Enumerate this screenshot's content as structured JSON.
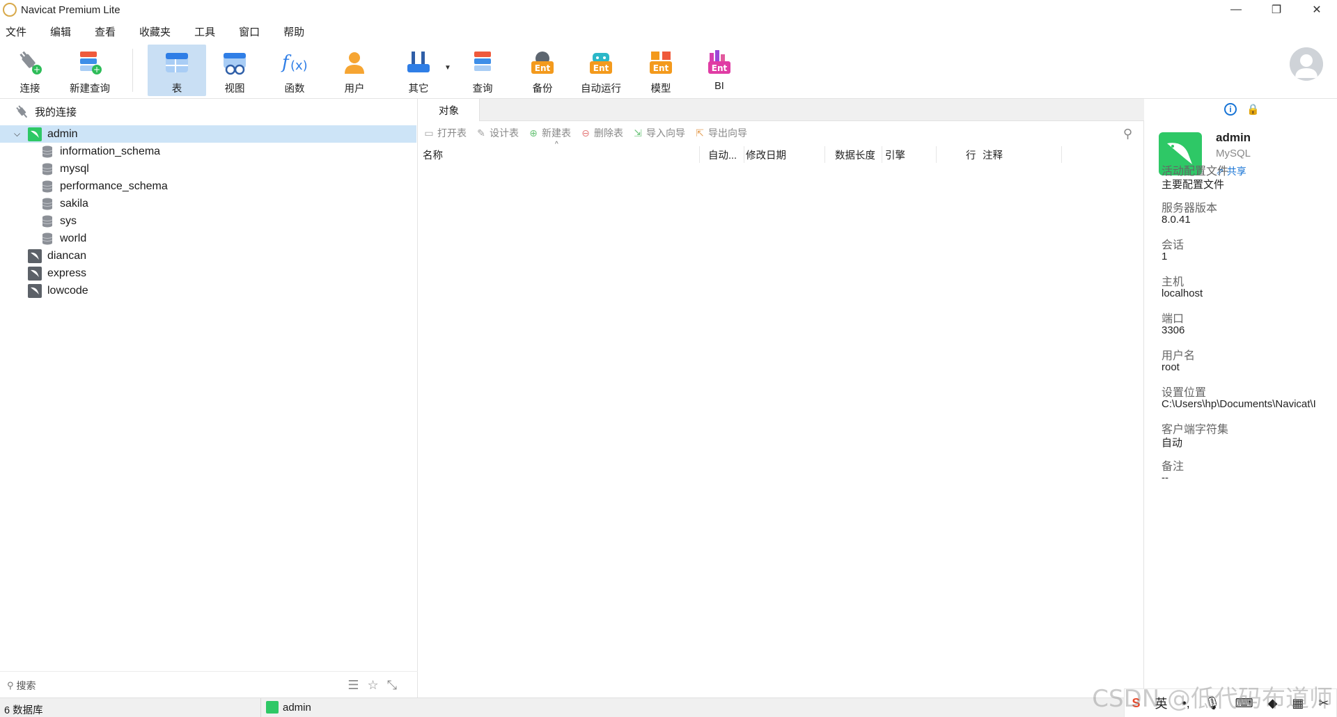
{
  "window": {
    "title": "Navicat Premium Lite",
    "controls": [
      "—",
      "❐",
      "✕"
    ]
  },
  "menu": [
    "文件",
    "编辑",
    "查看",
    "收藏夹",
    "工具",
    "窗口",
    "帮助"
  ],
  "toolbar": {
    "connect": "连接",
    "new_query": "新建查询",
    "table": "表",
    "view": "视图",
    "function": "函数",
    "user": "用户",
    "other": "其它",
    "query": "查询",
    "backup": "备份",
    "automation": "自动运行",
    "model": "模型",
    "bi": "BI",
    "ent_badge": "Ent"
  },
  "navigator": {
    "header": "我的连接",
    "connections": [
      {
        "name": "admin",
        "expanded": true,
        "selected": true,
        "databases": [
          "information_schema",
          "mysql",
          "performance_schema",
          "sakila",
          "sys",
          "world"
        ]
      },
      {
        "name": "diancan"
      },
      {
        "name": "express"
      },
      {
        "name": "lowcode"
      }
    ],
    "search_placeholder": "搜索"
  },
  "object_panel": {
    "tab": "对象",
    "actions": {
      "open": "打开表",
      "design": "设计表",
      "new": "新建表",
      "delete": "删除表",
      "import": "导入向导",
      "export": "导出向导"
    },
    "columns": {
      "name": "名称",
      "auto": "自动...",
      "modified": "修改日期",
      "data_length": "数据长度",
      "engine": "引擎",
      "rows": "行",
      "comment": "注释"
    }
  },
  "info_panel": {
    "connection_name": "admin",
    "connection_type": "MySQL",
    "share": "共享",
    "fields": [
      {
        "label": "活动配置文件",
        "value": "主要配置文件"
      },
      {
        "label": "服务器版本",
        "value": "8.0.41"
      },
      {
        "label": "会话",
        "value": "1"
      },
      {
        "label": "主机",
        "value": "localhost"
      },
      {
        "label": "端口",
        "value": "3306"
      },
      {
        "label": "用户名",
        "value": "root"
      },
      {
        "label": "设置位置",
        "value": "C:\\Users\\hp\\Documents\\Navicat\\I"
      },
      {
        "label": "客户端字符集",
        "value": "自动"
      },
      {
        "label": "备注",
        "value": "--"
      }
    ]
  },
  "status": {
    "db_count": "6 数据库",
    "current_connection": "admin"
  },
  "ime": {
    "lang": "英",
    "punct": "•,",
    "logo": "S"
  },
  "watermark": "CSDN @低代码布道师",
  "colors": {
    "accent": "#1673d5",
    "selection": "#cde4f7",
    "active_tool": "#c9dff4",
    "mysql_green": "#2ec866"
  }
}
